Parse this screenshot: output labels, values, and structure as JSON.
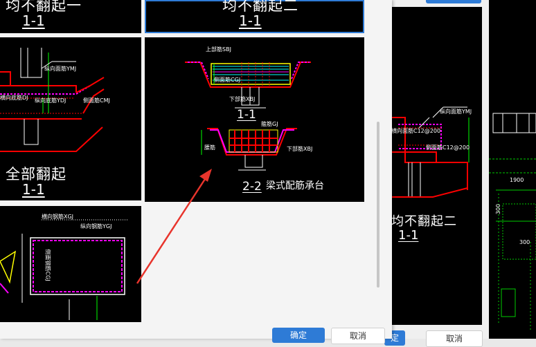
{
  "thumbs": {
    "t1": {
      "title": "均不翻起一",
      "sub": "1-1"
    },
    "t2": {
      "title": "均不翻起二",
      "sub": "1-1"
    },
    "t3": {
      "title": "全部翻起",
      "sub": "1-1",
      "labels": {
        "a": "纵向面筋YMJ",
        "b": "横向底筋DJ",
        "c": "纵向底筋YDJ",
        "d": "侧面筋CMJ"
      }
    },
    "t4": {
      "sub1": "1-1",
      "sub2": "2-2",
      "caption": "梁式配筋承台",
      "labels": {
        "a": "上部筋SBJ",
        "b": "侧面筋CGJ",
        "c": "下部筋XBJ",
        "d": "箍筋GJ",
        "e": "下部筋XBJ",
        "f": "腰筋"
      }
    },
    "t5": {
      "labels": {
        "a": "横向钢筋XGJ",
        "b": "纵向钢筋YGJ",
        "c": "侧面钢筋CGJ"
      }
    }
  },
  "right_panel": {
    "title": "均不翻起二",
    "sub": "1-1",
    "labels": {
      "a": "纵向面筋YMJ",
      "b": "横向面筋C12@200",
      "c": "侧面筋C12@200"
    }
  },
  "far_right": {
    "labels": {
      "a": "1900",
      "b": "300",
      "c": "300"
    }
  },
  "dialog": {
    "ok_label": "确定",
    "cancel_label": "取消"
  },
  "back": {
    "ok_label": "定",
    "cancel_label": "取消"
  }
}
